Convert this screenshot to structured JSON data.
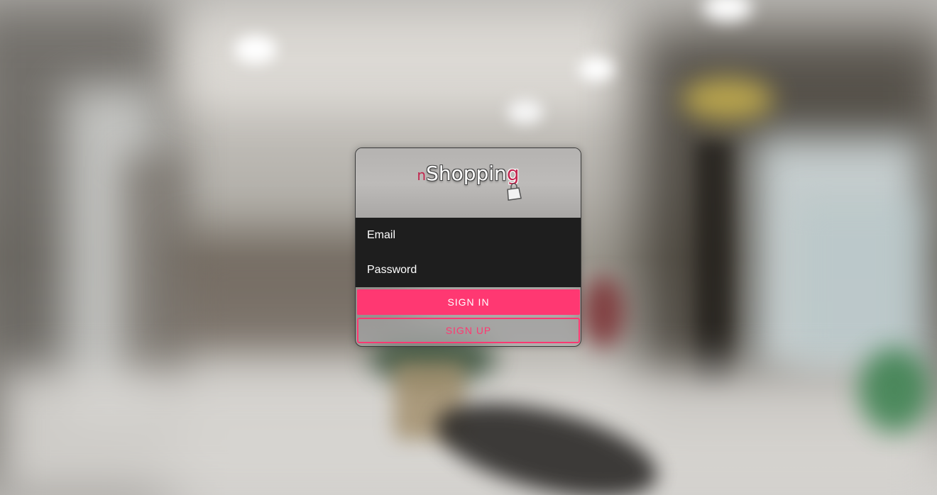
{
  "logo": {
    "prefix": "n",
    "main": "Shoppin",
    "suffix": "g",
    "icon": "shopping-bag-icon"
  },
  "form": {
    "email": {
      "placeholder": "Email",
      "value": ""
    },
    "password": {
      "placeholder": "Password",
      "value": ""
    },
    "signin_label": "SIGN IN",
    "signup_label": "SIGN UP"
  },
  "colors": {
    "accent": "#ff3872",
    "logo_accent": "#c2264f",
    "field_background": "#1e1e1e"
  }
}
